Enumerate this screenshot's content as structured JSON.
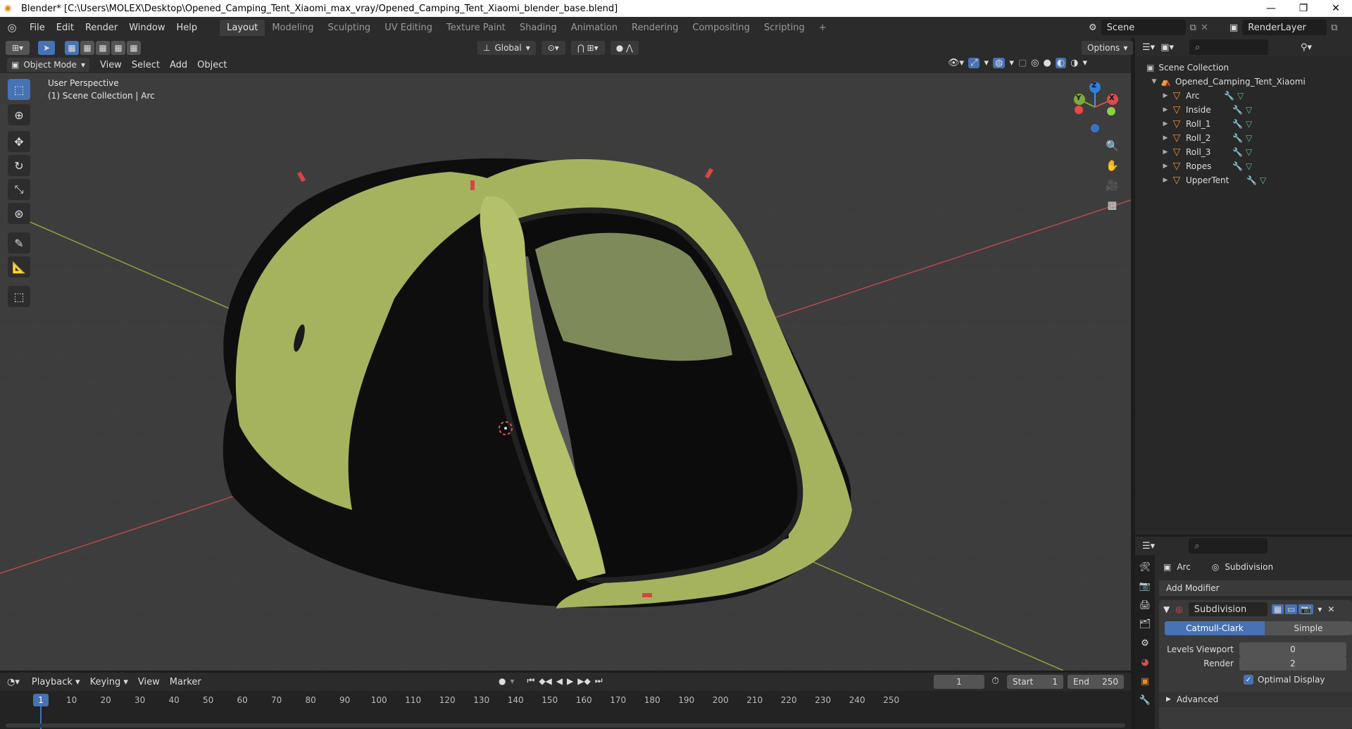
{
  "window": {
    "title": "Blender* [C:\\Users\\MOLEX\\Desktop\\Opened_Camping_Tent_Xiaomi_max_vray/Opened_Camping_Tent_Xiaomi_blender_base.blend]",
    "minimize": "—",
    "restore": "❐",
    "close": "✕"
  },
  "menu": [
    "File",
    "Edit",
    "Render",
    "Window",
    "Help"
  ],
  "workspaces": [
    "Layout",
    "Modeling",
    "Sculpting",
    "UV Editing",
    "Texture Paint",
    "Shading",
    "Animation",
    "Rendering",
    "Compositing",
    "Scripting"
  ],
  "workspace_add": "+",
  "active_workspace": "Layout",
  "scene": {
    "name": "Scene",
    "render_layer": "RenderLayer"
  },
  "toolbar": {
    "orientation": "Global",
    "options": "Options"
  },
  "viewport_header": {
    "mode": "Object Mode",
    "menus": [
      "View",
      "Select",
      "Add",
      "Object"
    ]
  },
  "viewport": {
    "perspective_label": "User Perspective",
    "collection_label": "(1) Scene Collection | Arc",
    "gizmo_axes": {
      "z": "Z",
      "y": "Y",
      "x": "X"
    }
  },
  "outliner": {
    "root": "Scene Collection",
    "collection": "Opened_Camping_Tent_Xiaomi",
    "objects": [
      "Arc",
      "Inside",
      "Roll_1",
      "Roll_2",
      "Roll_3",
      "Ropes",
      "UpperTent"
    ]
  },
  "properties": {
    "object_name": "Arc",
    "modifier_name": "Subdivision",
    "add_modifier": "Add Modifier",
    "modifier_field": "Subdivision",
    "tabs": [
      "Catmull-Clark",
      "Simple"
    ],
    "active_tab": "Catmull-Clark",
    "levels_viewport_label": "Levels Viewport",
    "levels_viewport_value": "0",
    "render_label": "Render",
    "render_value": "2",
    "optimal_display_label": "Optimal Display",
    "optimal_display_checked": true,
    "advanced_label": "Advanced"
  },
  "timeline": {
    "menus": [
      "Playback",
      "Keying",
      "View",
      "Marker"
    ],
    "current_frame": "1",
    "start_label": "Start",
    "start_value": "1",
    "end_label": "End",
    "end_value": "250",
    "playhead": "1",
    "ticks": [
      "10",
      "20",
      "30",
      "40",
      "50",
      "60",
      "70",
      "80",
      "90",
      "100",
      "110",
      "120",
      "130",
      "140",
      "150",
      "160",
      "170",
      "180",
      "190",
      "200",
      "210",
      "220",
      "230",
      "240",
      "250"
    ]
  },
  "colors": {
    "accent": "#4772b3",
    "tent_green": "#a6b35e",
    "tent_dark": "#0e0e0e",
    "grid_bg": "#3d3d3d",
    "x_axis": "#b84a4a",
    "y_axis": "#8ba23c",
    "orange_icon": "#e28d3c"
  }
}
